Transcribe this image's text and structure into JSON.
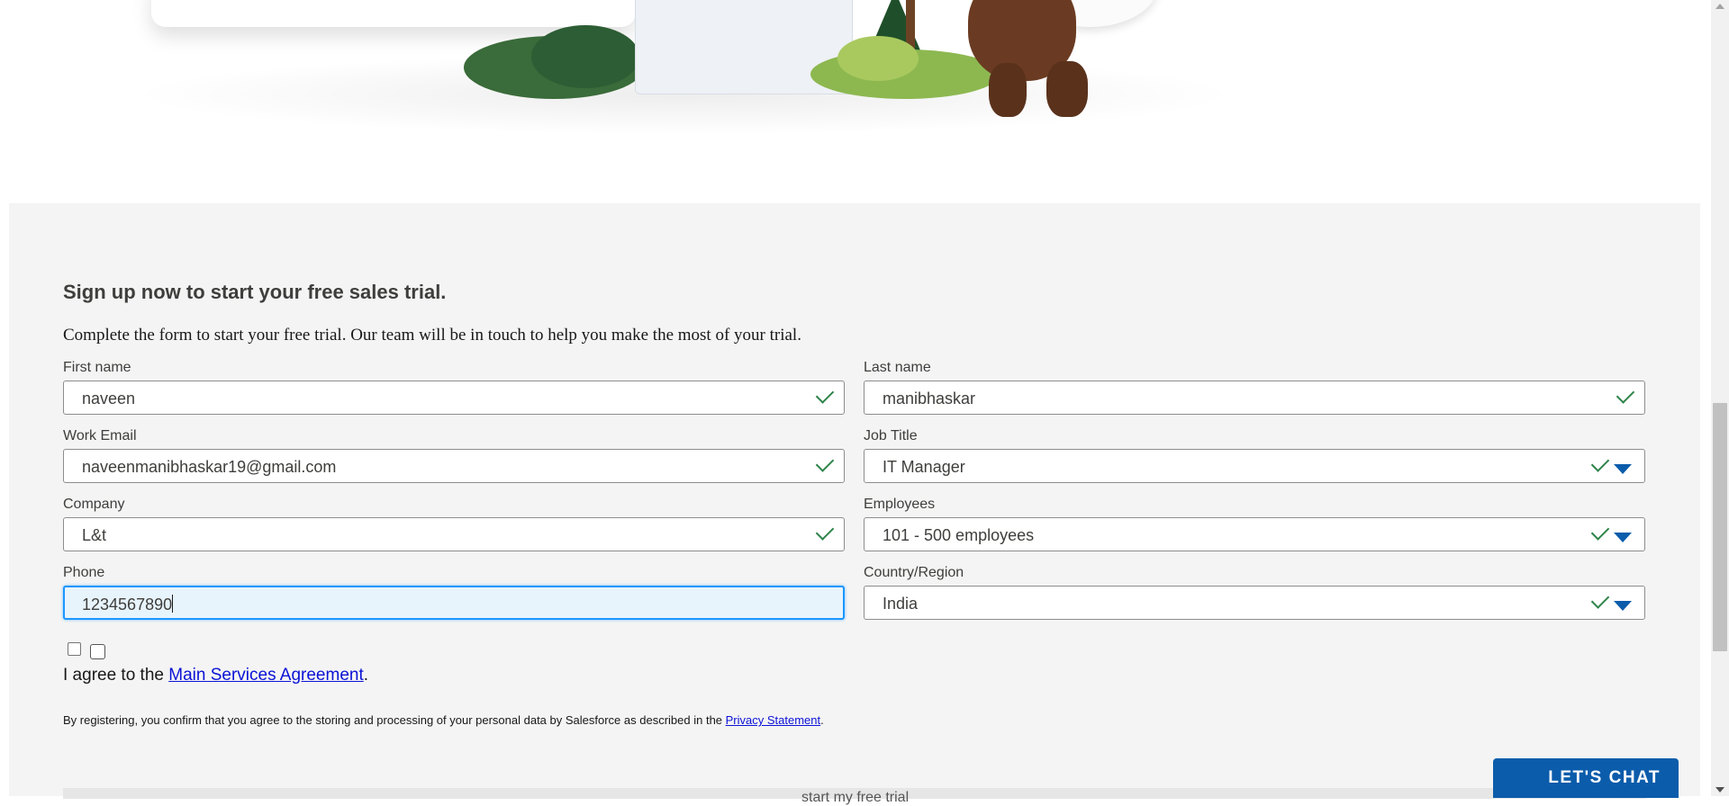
{
  "form": {
    "heading": "Sign up now to start your free sales trial.",
    "subtext": "Complete the form to start your free trial. Our team will be in touch to help you make the most of your trial.",
    "fields": {
      "first_name": {
        "label": "First name",
        "value": "naveen"
      },
      "last_name": {
        "label": "Last name",
        "value": "manibhaskar"
      },
      "work_email": {
        "label": "Work Email",
        "value": "naveenmanibhaskar19@gmail.com"
      },
      "job_title": {
        "label": "Job Title",
        "value": "IT Manager"
      },
      "company": {
        "label": "Company",
        "value": "L&t"
      },
      "employees": {
        "label": "Employees",
        "value": "101 - 500 employees"
      },
      "phone": {
        "label": "Phone",
        "value": "1234567890"
      },
      "country": {
        "label": "Country/Region",
        "value": "India"
      }
    },
    "agree_prefix": "I agree to the ",
    "agree_link": "Main Services Agreement",
    "agree_suffix": ".",
    "legal_prefix": "By registering, you confirm that you agree to the storing and processing of your personal data by Salesforce as described in the ",
    "legal_link": "Privacy Statement",
    "legal_suffix": ".",
    "submit_label_partial": "start my free trial"
  },
  "chat": {
    "label": "LET'S CHAT"
  },
  "colors": {
    "accent": "#0b5cab",
    "check": "#2e844a",
    "focus": "#1b96ff",
    "link": "#0b12d6",
    "section_bg": "#f4f4f4"
  }
}
